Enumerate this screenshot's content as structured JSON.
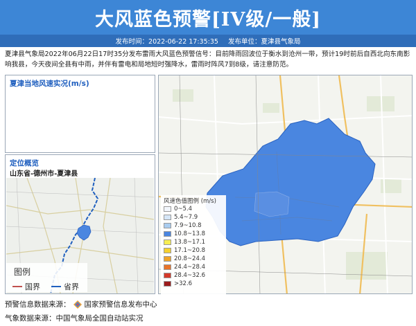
{
  "header": {
    "title": "大风蓝色预警[IV级/一般]",
    "publish_time": "发布时间：2022-06-22 17:35:35",
    "publisher": "发布单位：夏津县气象局"
  },
  "description": "夏津县气象局2022年06月22日17时35分发布雷雨大风蓝色预警信号：目前降雨回波位于衡水到沧州一带，预计19时前后自西北向东南影响我县，今天夜间全县有中雨，并伴有雷电和局地短时强降水，雷雨时阵风7到8级，请注意防范。",
  "wind_panel": {
    "title": "夏津当地风速实况(m/s)"
  },
  "location_panel": {
    "title": "定位概览",
    "path": "山东省-德州市-夏津县",
    "legend_title": "图例",
    "legend_items": [
      {
        "label": "国界",
        "color": "#c0504d"
      },
      {
        "label": "省界",
        "color": "#1f5fbf"
      }
    ]
  },
  "wind_legend": {
    "title": "风速色值图例 (m/s)",
    "items": [
      {
        "label": "0~5.4",
        "color": "#f2f6fc"
      },
      {
        "label": "5.4~7.9",
        "color": "#d5e6f7"
      },
      {
        "label": "7.9~10.8",
        "color": "#a9ccef"
      },
      {
        "label": "10.8~13.8",
        "color": "#4a86e0"
      },
      {
        "label": "13.8~17.1",
        "color": "#f7ee53"
      },
      {
        "label": "17.1~20.8",
        "color": "#f5d12f"
      },
      {
        "label": "20.8~24.4",
        "color": "#f0a428"
      },
      {
        "label": "24.4~28.4",
        "color": "#e8742a"
      },
      {
        "label": "28.4~32.6",
        "color": "#d43a2a"
      },
      {
        "label": ">32.6",
        "color": "#9c1c1c"
      }
    ]
  },
  "footer": {
    "warning_source": "预警信息数据来源：",
    "warning_source_name": "国家预警信息发布中心",
    "weather_source": "气象数据来源：中国气象局全国自动站实况"
  },
  "colors": {
    "banner": "#3d86d6",
    "subbar": "#2f6db9",
    "warning_area": "#4a86e0"
  }
}
